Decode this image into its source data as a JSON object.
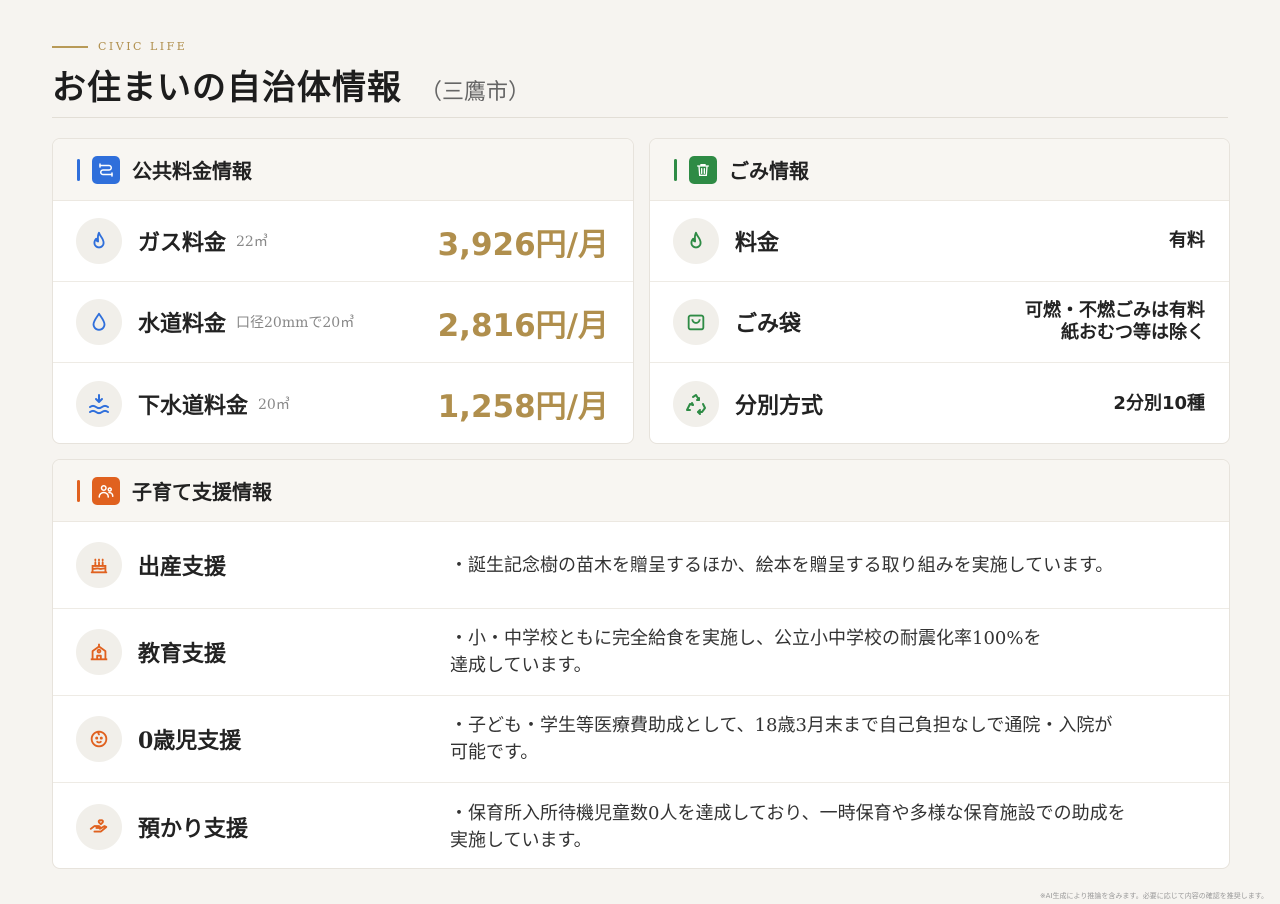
{
  "header": {
    "eyebrow": "CIVIC LIFE",
    "title": "お住まいの自治体情報",
    "subtitle": "（三鷹市）"
  },
  "colors": {
    "accent_gold": "#b08f4d",
    "utility_blue": "#2f6fdb",
    "garbage_green": "#2e8b45",
    "child_orange": "#e0611f"
  },
  "utility": {
    "title": "公共料金情報",
    "icon": "pipe-icon",
    "rows": [
      {
        "icon": "flame-icon",
        "label": "ガス料金",
        "note": "22㎥",
        "value": "3,926円/月"
      },
      {
        "icon": "water-drop-icon",
        "label": "水道料金",
        "note": "口径20mmで20㎥",
        "value": "2,816円/月"
      },
      {
        "icon": "sewer-waves-icon",
        "label": "下水道料金",
        "note": "20㎥",
        "value": "1,258円/月"
      }
    ]
  },
  "garbage": {
    "title": "ごみ情報",
    "icon": "trash-icon",
    "rows": [
      {
        "icon": "flame-icon",
        "label": "料金",
        "value": [
          "有料"
        ]
      },
      {
        "icon": "bag-icon",
        "label": "ごみ袋",
        "value": [
          "可燃・不燃ごみは有料",
          "紙おむつ等は除く"
        ]
      },
      {
        "icon": "recycle-icon",
        "label": "分別方式",
        "value": [
          "2分別10種"
        ]
      }
    ]
  },
  "child": {
    "title": "子育て支援情報",
    "icon": "family-icon",
    "rows": [
      {
        "icon": "cake-icon",
        "label": "出産支援",
        "desc": [
          "・誕生記念樹の苗木を贈呈するほか、絵本を贈呈する取り組みを実施しています。"
        ]
      },
      {
        "icon": "school-icon",
        "label": "教育支援",
        "desc": [
          "・小・中学校ともに完全給食を実施し、公立小中学校の耐震化率100%を",
          "達成しています。"
        ]
      },
      {
        "icon": "baby-icon",
        "label": "0歳児支援",
        "desc": [
          "・子ども・学生等医療費助成として、18歳3月末まで自己負担なしで通院・入院が",
          "可能です。"
        ]
      },
      {
        "icon": "hand-care-icon",
        "label": "預かり支援",
        "desc": [
          "・保育所入所待機児童数0人を達成しており、一時保育や多様な保育施設での助成を",
          "実施しています。"
        ]
      }
    ]
  },
  "footnote": "※AI生成により推論を含みます。必要に応じて内容の確認を推奨します。"
}
